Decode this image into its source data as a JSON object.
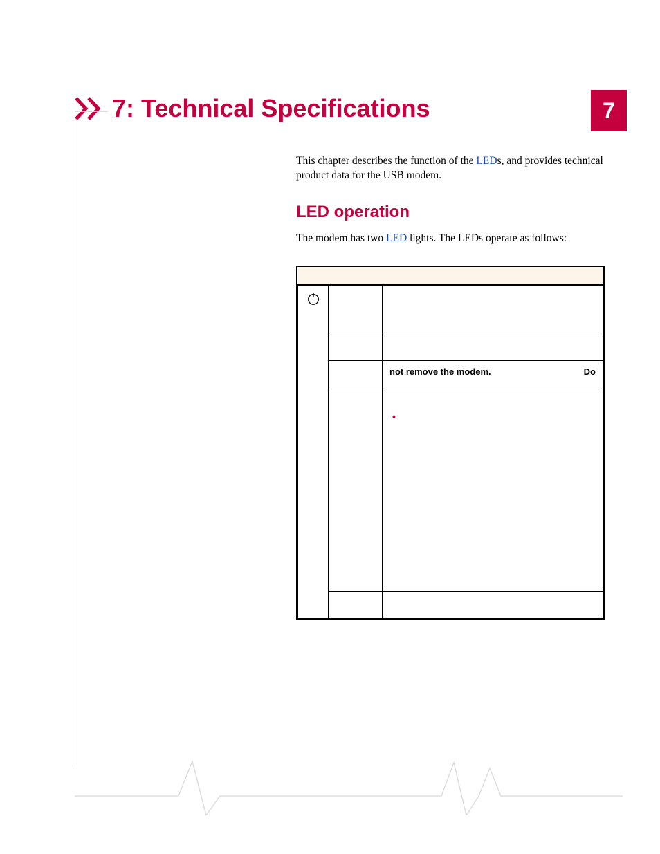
{
  "chapter": {
    "tab_number": "7",
    "title": "7: Technical Specifications"
  },
  "intro": {
    "before_link": "This chapter describes the function of the ",
    "link": "LED",
    "after_link": "s, and provides technical product data for the USB modem."
  },
  "section": {
    "heading": "LED operation",
    "body_before_link": "The modem has two ",
    "body_link": "LED",
    "body_after_link": " lights. The LEDs operate as follows:"
  },
  "table": {
    "icon_name": "power-icon",
    "warn_before": "",
    "warn_bold_a": "Do",
    "warn_bold_b": "not remove the modem.",
    "bullets": [
      "",
      "",
      "",
      "",
      ""
    ]
  }
}
